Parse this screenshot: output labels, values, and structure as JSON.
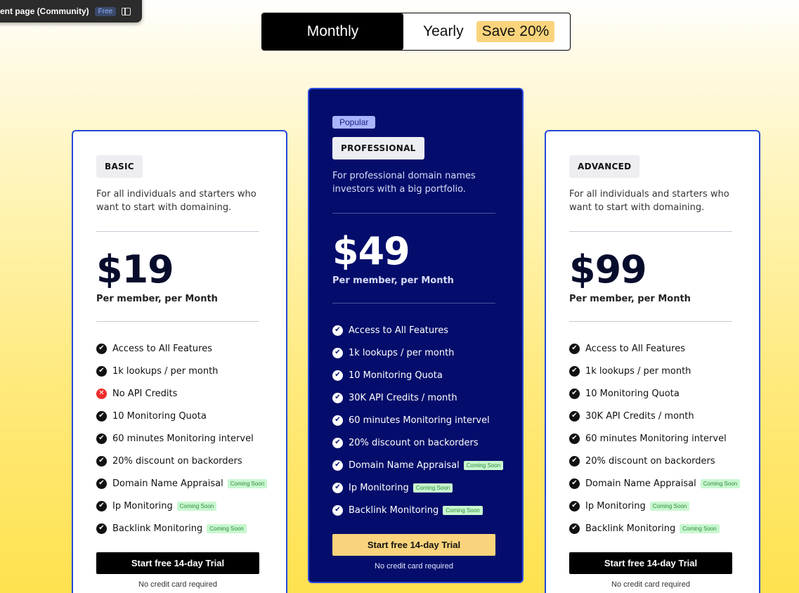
{
  "topbar": {
    "title": "ent page (Community)",
    "badge": "Free"
  },
  "toggle": {
    "monthly": "Monthly",
    "yearly": "Yearly",
    "save": "Save 20%"
  },
  "plans": {
    "basic": {
      "tier": "BASIC",
      "description": "For all individuals and starters who want to start with domaining.",
      "price": "$19",
      "per": "Per member, per Month",
      "features": [
        {
          "text": "Access to All Features",
          "icon": "check",
          "badge": ""
        },
        {
          "text": "1k lookups / per month",
          "icon": "check",
          "badge": ""
        },
        {
          "text": "No API Credits",
          "icon": "x",
          "badge": ""
        },
        {
          "text": "10 Monitoring Quota",
          "icon": "check",
          "badge": ""
        },
        {
          "text": "60 minutes Monitoring intervel",
          "icon": "check",
          "badge": ""
        },
        {
          "text": "20% discount on backorders",
          "icon": "check",
          "badge": ""
        },
        {
          "text": "Domain Name Appraisal",
          "icon": "check",
          "badge": "Coming Soon"
        },
        {
          "text": "Ip Monitoring",
          "icon": "check",
          "badge": "Coming Soon"
        },
        {
          "text": "Backlink Monitoring",
          "icon": "check",
          "badge": "Coming Soon"
        }
      ],
      "cta": "Start free 14-day Trial",
      "note": "No credit card required"
    },
    "professional": {
      "popular": "Popular",
      "tier": "PROFESSIONAL",
      "description": "For professional domain names investors with a big portfolio.",
      "price": "$49",
      "per": "Per member, per Month",
      "features": [
        {
          "text": "Access to All Features",
          "icon": "check",
          "badge": ""
        },
        {
          "text": "1k lookups / per month",
          "icon": "check",
          "badge": ""
        },
        {
          "text": "10 Monitoring Quota",
          "icon": "check",
          "badge": ""
        },
        {
          "text": "30K API Credits / month",
          "icon": "check",
          "badge": ""
        },
        {
          "text": "60 minutes Monitoring intervel",
          "icon": "check",
          "badge": ""
        },
        {
          "text": "20% discount on backorders",
          "icon": "check",
          "badge": ""
        },
        {
          "text": "Domain Name Appraisal",
          "icon": "check",
          "badge": "Coming Soon"
        },
        {
          "text": "Ip Monitoring",
          "icon": "check",
          "badge": "Coming Soon"
        },
        {
          "text": "Backlink Monitoring",
          "icon": "check",
          "badge": "Coming Soon"
        }
      ],
      "cta": "Start free 14-day Trial",
      "note": "No credit card required"
    },
    "advanced": {
      "tier": "ADVANCED",
      "description": "For all individuals and starters who want to start with domaining.",
      "price": "$99",
      "per": "Per member, per Month",
      "features": [
        {
          "text": "Access to All Features",
          "icon": "check",
          "badge": ""
        },
        {
          "text": "1k lookups / per month",
          "icon": "check",
          "badge": ""
        },
        {
          "text": "10 Monitoring Quota",
          "icon": "check",
          "badge": ""
        },
        {
          "text": "30K API Credits / month",
          "icon": "check",
          "badge": ""
        },
        {
          "text": "60 minutes Monitoring intervel",
          "icon": "check",
          "badge": ""
        },
        {
          "text": "20% discount on backorders",
          "icon": "check",
          "badge": ""
        },
        {
          "text": "Domain Name Appraisal",
          "icon": "check",
          "badge": "Coming Soon"
        },
        {
          "text": "Ip Monitoring",
          "icon": "check",
          "badge": "Coming Soon"
        },
        {
          "text": "Backlink Monitoring",
          "icon": "check",
          "badge": "Coming Soon"
        }
      ],
      "cta": "Start free 14-day Trial",
      "note": "No credit card required"
    }
  },
  "colors": {
    "navy": "#040d6b",
    "accent_yellow": "#fad47c",
    "border_blue": "#2347d8",
    "soon_green": "#c8f7cf",
    "error_red": "#ee2b2b"
  }
}
